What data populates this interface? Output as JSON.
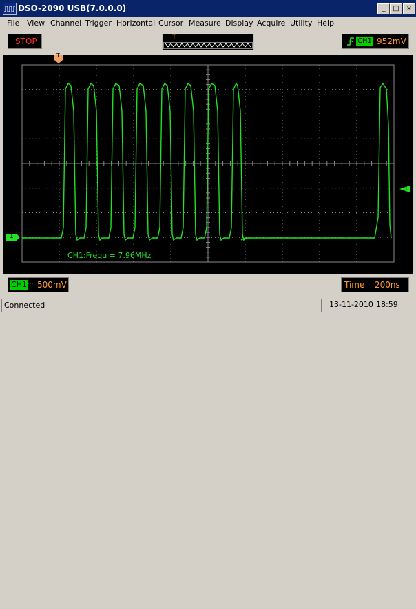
{
  "window": {
    "title": "DSO-2090 USB(7.0.0.0)",
    "minimize_glyph": "_",
    "maximize_glyph": "□",
    "close_glyph": "×"
  },
  "menu": [
    {
      "label": "File"
    },
    {
      "label": "View"
    },
    {
      "label": "Channel"
    },
    {
      "label": "Trigger"
    },
    {
      "label": "Horizontal"
    },
    {
      "label": "Cursor"
    },
    {
      "label": "Measure"
    },
    {
      "label": "Display"
    },
    {
      "label": "Acquire"
    },
    {
      "label": "Utility"
    },
    {
      "label": "Help"
    }
  ],
  "toolbar": {
    "run_status": "STOP",
    "trigger_marker": "T",
    "trigger_icon": "rising-edge-icon",
    "trigger_channel": "CH1",
    "trigger_level": "952mV"
  },
  "scope": {
    "trigger_pos_marker": "T",
    "channel_marker": "1",
    "trigger_level_marker": "T",
    "measurement": "CH1:Frequ = 7.96MHz"
  },
  "bottom": {
    "channel": "CH1",
    "coupling_glyph": "⎓",
    "volts_div": "500mV",
    "time_label": "Time",
    "time_div": "200ns"
  },
  "status": {
    "left": "Connected",
    "date": "13-11-2010",
    "time": "18:59"
  },
  "colors": {
    "trace": "#22e022",
    "grid": "#8a8a8a",
    "stop_text": "#ff3030",
    "value_text": "#ff9933",
    "channel_bg": "#00d000",
    "marker_orange": "#f4a060"
  }
}
